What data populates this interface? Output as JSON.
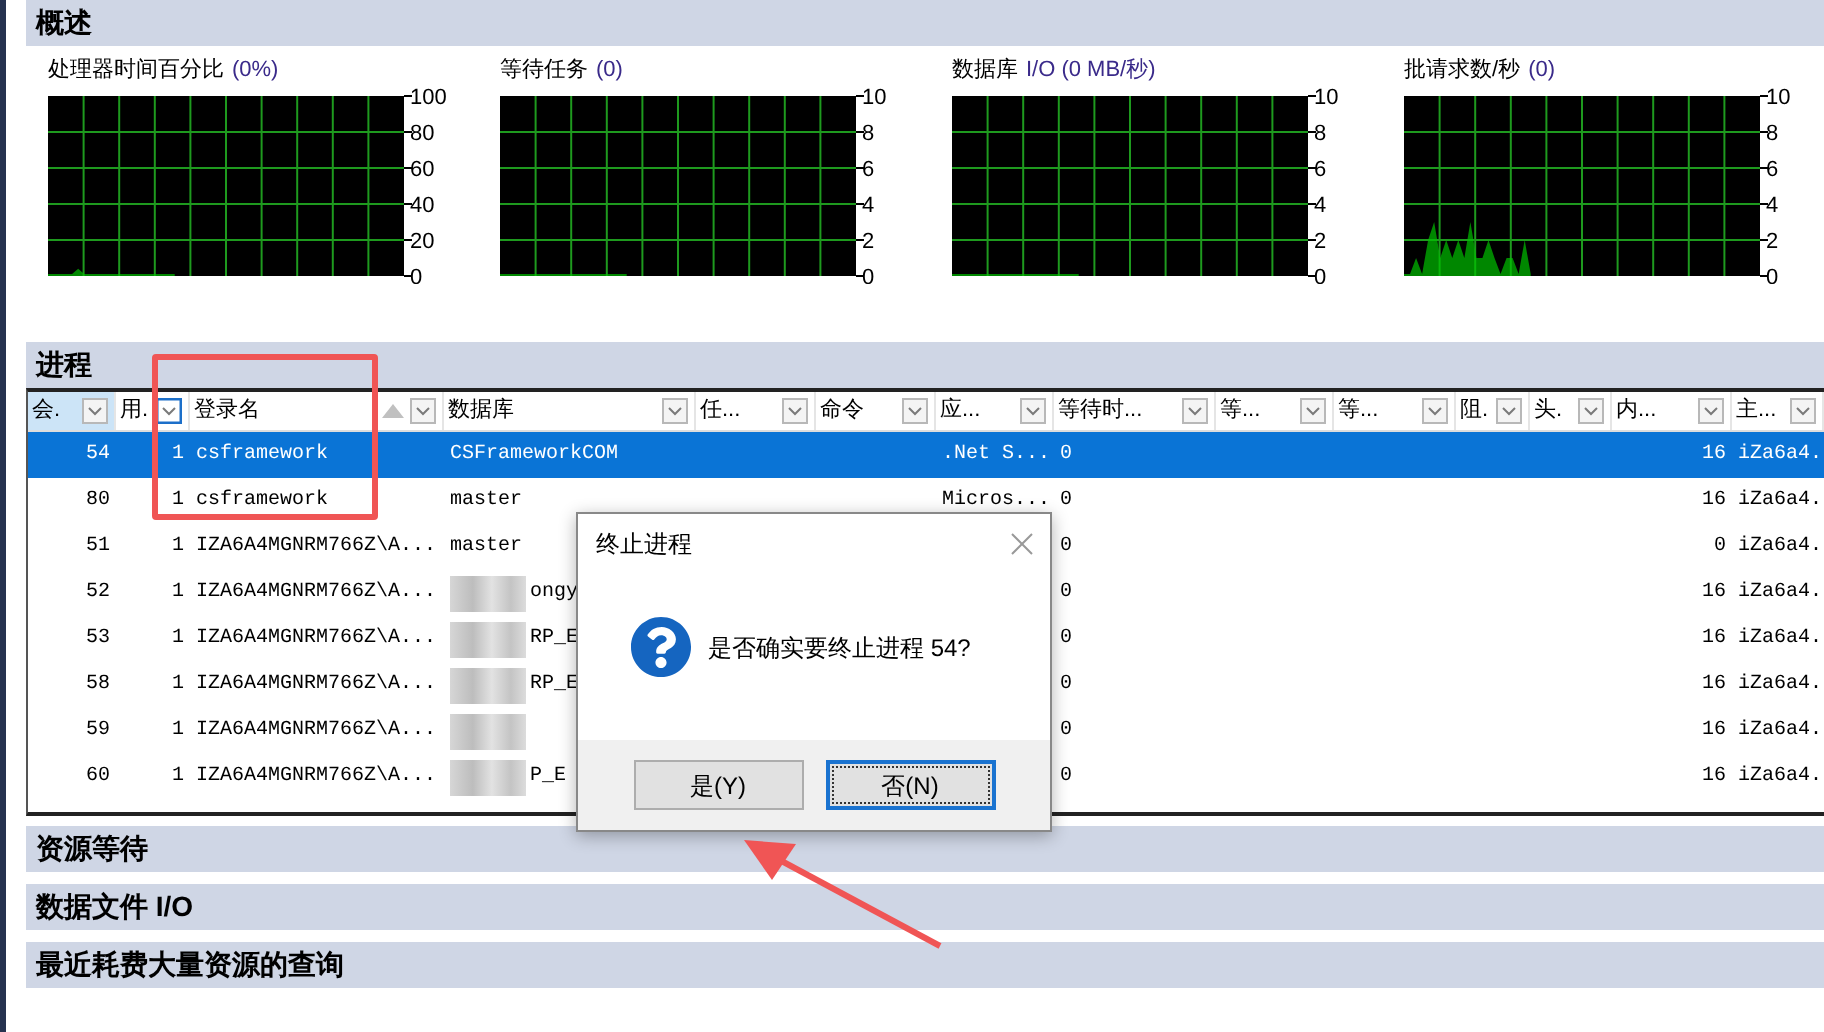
{
  "overview": {
    "title": "概述",
    "charts": [
      {
        "title": "处理器时间百分比",
        "reading": "(0%)",
        "chart_data": {
          "type": "area",
          "grid": true,
          "ylim": [
            0,
            100
          ],
          "yticks": [
            0,
            20,
            40,
            60,
            80,
            100
          ],
          "series": [
            {
              "color": "#00c000",
              "values": [
                0,
                0,
                0,
                0,
                0,
                4,
                0,
                0,
                0,
                0,
                0,
                0,
                0,
                0,
                0,
                0,
                0,
                0,
                0,
                0,
                0,
                0,
                null,
                null,
                null,
                null,
                null,
                null,
                null,
                null,
                null,
                null,
                null,
                null,
                null,
                null,
                null,
                null,
                null,
                null,
                null,
                null,
                null,
                null,
                null,
                null,
                null,
                null,
                null,
                null,
                null,
                null,
                null,
                null,
                null,
                null,
                null,
                null,
                null,
                null
              ]
            }
          ]
        }
      },
      {
        "title": "等待任务",
        "reading": "(0)",
        "chart_data": {
          "type": "area",
          "grid": true,
          "ylim": [
            0,
            10
          ],
          "yticks": [
            0,
            2,
            4,
            6,
            8,
            10
          ],
          "series": [
            {
              "color": "#00c000",
              "values": [
                0,
                0,
                0,
                0,
                0,
                0,
                0,
                0,
                0,
                0,
                0,
                0,
                0,
                0,
                0,
                0,
                0,
                0,
                0,
                0,
                0,
                0,
                null,
                null,
                null,
                null,
                null,
                null,
                null,
                null,
                null,
                null,
                null,
                null,
                null,
                null,
                null,
                null,
                null,
                null,
                null,
                null,
                null,
                null,
                null,
                null,
                null,
                null,
                null,
                null,
                null,
                null,
                null,
                null,
                null,
                null,
                null,
                null,
                null,
                null
              ]
            }
          ]
        }
      },
      {
        "title": "数据库",
        "reading": "I/O (0 MB/秒)",
        "chart_data": {
          "type": "area",
          "grid": true,
          "ylim": [
            0,
            10
          ],
          "yticks": [
            0,
            2,
            4,
            6,
            8,
            10
          ],
          "series": [
            {
              "color": "#00c000",
              "values": [
                0,
                0,
                0,
                0,
                0,
                0,
                0,
                0,
                0,
                0,
                0,
                0,
                0,
                0,
                0,
                0,
                0,
                0,
                0,
                0,
                0,
                0,
                null,
                null,
                null,
                null,
                null,
                null,
                null,
                null,
                null,
                null,
                null,
                null,
                null,
                null,
                null,
                null,
                null,
                null,
                null,
                null,
                null,
                null,
                null,
                null,
                null,
                null,
                null,
                null,
                null,
                null,
                null,
                null,
                null,
                null,
                null,
                null,
                null,
                null
              ]
            }
          ]
        }
      },
      {
        "title": "批请求数/秒",
        "reading": "(0)",
        "chart_data": {
          "type": "area",
          "grid": true,
          "ylim": [
            0,
            10
          ],
          "yticks": [
            0,
            2,
            4,
            6,
            8,
            10
          ],
          "series": [
            {
              "color": "#00c000",
              "values": [
                0,
                0,
                1,
                0,
                2,
                3,
                1,
                2,
                1,
                2,
                1,
                3,
                1,
                1,
                2,
                1,
                0,
                1,
                1,
                0,
                2,
                0,
                null,
                null,
                null,
                null,
                null,
                null,
                null,
                null,
                null,
                null,
                null,
                null,
                null,
                null,
                null,
                null,
                null,
                null,
                null,
                null,
                null,
                null,
                null,
                null,
                null,
                null,
                null,
                null,
                null,
                null,
                null,
                null,
                null,
                null,
                null,
                null,
                null,
                null
              ]
            }
          ]
        }
      }
    ]
  },
  "processes": {
    "title": "进程",
    "columns": [
      {
        "label": "会.",
        "selected": true,
        "sorted_ascending": false,
        "filter_focused": false
      },
      {
        "label": "用.",
        "selected": false,
        "sorted_ascending": false,
        "filter_focused": true
      },
      {
        "label": "登录名",
        "selected": false,
        "sorted_ascending": true,
        "filter_focused": false
      },
      {
        "label": "数据库",
        "selected": false,
        "sorted_ascending": false,
        "filter_focused": false
      },
      {
        "label": "任...",
        "selected": false,
        "sorted_ascending": false,
        "filter_focused": false
      },
      {
        "label": "命令",
        "selected": false,
        "sorted_ascending": false,
        "filter_focused": false
      },
      {
        "label": "应...",
        "selected": false,
        "sorted_ascending": false,
        "filter_focused": false
      },
      {
        "label": "等待时...",
        "selected": false,
        "sorted_ascending": false,
        "filter_focused": false
      },
      {
        "label": "等...",
        "selected": false,
        "sorted_ascending": false,
        "filter_focused": false
      },
      {
        "label": "等...",
        "selected": false,
        "sorted_ascending": false,
        "filter_focused": false
      },
      {
        "label": "阻.",
        "selected": false,
        "sorted_ascending": false,
        "filter_focused": false
      },
      {
        "label": "头.",
        "selected": false,
        "sorted_ascending": false,
        "filter_focused": false
      },
      {
        "label": "内...",
        "selected": false,
        "sorted_ascending": false,
        "filter_focused": false
      },
      {
        "label": "主...",
        "selected": false,
        "sorted_ascending": false,
        "filter_focused": false
      }
    ],
    "rows": [
      {
        "selected": true,
        "database_blurred": false,
        "column_1": "54",
        "column_2": "1",
        "column_3": "csframework",
        "column_4": "CSFrameworkCOM",
        "column_7": ".Net S...",
        "column_8": "0",
        "column_13": "16",
        "column_14": "iZa6a4."
      },
      {
        "selected": false,
        "database_blurred": false,
        "column_1": "80",
        "column_2": "1",
        "column_3": "csframework",
        "column_4": "master",
        "column_7": "Micros...",
        "column_8": "0",
        "column_13": "16",
        "column_14": "iZa6a4."
      },
      {
        "selected": false,
        "database_blurred": false,
        "column_1": "51",
        "column_2": "1",
        "column_3": "IZA6A4MGNRM766Z\\A...",
        "column_4": "master",
        "column_8": "0",
        "column_13": "0",
        "column_14": "iZa6a4."
      },
      {
        "selected": false,
        "database_blurred": true,
        "column_1": "52",
        "column_2": "1",
        "column_3": "IZA6A4MGNRM766Z\\A...",
        "column_4": "ongy",
        "column_8": "0",
        "column_13": "16",
        "column_14": "iZa6a4."
      },
      {
        "selected": false,
        "database_blurred": true,
        "column_1": "53",
        "column_2": "1",
        "column_3": "IZA6A4MGNRM766Z\\A...",
        "column_4": "RP_E",
        "column_8": "0",
        "column_13": "16",
        "column_14": "iZa6a4."
      },
      {
        "selected": false,
        "database_blurred": true,
        "column_1": "58",
        "column_2": "1",
        "column_3": "IZA6A4MGNRM766Z\\A...",
        "column_4": "RP_E",
        "column_8": "0",
        "column_13": "16",
        "column_14": "iZa6a4."
      },
      {
        "selected": false,
        "database_blurred": true,
        "column_1": "59",
        "column_2": "1",
        "column_3": "IZA6A4MGNRM766Z\\A...",
        "column_8": "0",
        "column_13": "16",
        "column_14": "iZa6a4."
      },
      {
        "selected": false,
        "database_blurred": true,
        "column_1": "60",
        "column_2": "1",
        "column_3": "IZA6A4MGNRM766Z\\A...",
        "column_4": "P_E",
        "column_8": "0",
        "column_13": "16",
        "column_14": "iZa6a4."
      }
    ]
  },
  "sections": [
    {
      "title": "资源等待"
    },
    {
      "title": "数据文件 I/O"
    },
    {
      "title": "最近耗费大量资源的查询"
    }
  ],
  "dialog": {
    "title": "终止进程",
    "message": "是否确实要终止进程 54?",
    "buttons": [
      {
        "label": "是(Y)",
        "focused": false
      },
      {
        "label": "否(N)",
        "focused": true
      }
    ]
  }
}
